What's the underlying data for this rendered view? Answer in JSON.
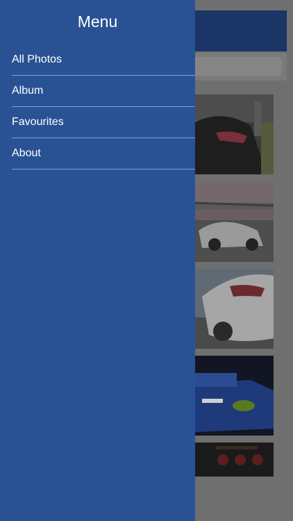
{
  "drawer": {
    "title": "Menu",
    "items": [
      {
        "label": "All Photos"
      },
      {
        "label": "Album"
      },
      {
        "label": "Favourites"
      },
      {
        "label": "About"
      }
    ]
  },
  "colors": {
    "drawer_bg": "#295294",
    "overlay": "#6f6f6f",
    "header_bg": "#1a3566"
  }
}
